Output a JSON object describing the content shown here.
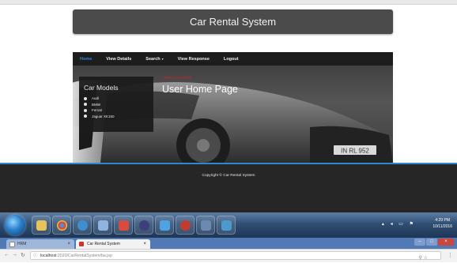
{
  "app": {
    "header_title": "Car Rental System"
  },
  "nav": {
    "items": [
      {
        "label": "Home",
        "active": true
      },
      {
        "label": "View Details",
        "active": false
      },
      {
        "label": "Search",
        "active": false,
        "dropdown": true
      },
      {
        "label": "View Response",
        "active": false
      },
      {
        "label": "Logout",
        "active": false
      }
    ],
    "caret": "▾"
  },
  "sidebar": {
    "title": "Car Models",
    "models": [
      "Audi",
      "BMW",
      "Ferrari",
      "Jaguar XK150"
    ]
  },
  "main": {
    "login_message": "Login successful",
    "page_title": "User Home Page"
  },
  "footer": {
    "copyright": "Copyright © Car Rental System"
  },
  "taskbar": {
    "time": "4:29 PM",
    "date": "10/11/2016"
  },
  "browser": {
    "tabs": [
      {
        "title": "HRM",
        "active": false
      },
      {
        "title": "Car Rental System",
        "active": true
      }
    ],
    "address_host": "localhost",
    "address_path": ":2020/CarRentalSystem/ba.jsp"
  },
  "colors": {
    "accent": "#2f86d6",
    "login_message": "#c1272d"
  }
}
